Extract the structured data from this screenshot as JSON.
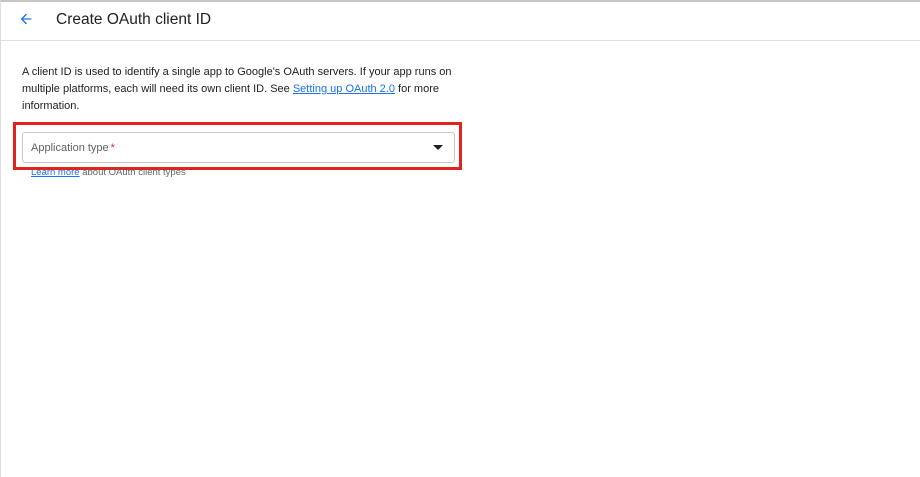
{
  "header": {
    "title": "Create OAuth client ID",
    "back_icon": "arrow-back-icon"
  },
  "intro": {
    "text_before_link": "A client ID is used to identify a single app to Google's OAuth servers. If your app runs on multiple platforms, each will need its own client ID. See ",
    "link_text": "Setting up OAuth 2.0",
    "text_after_link": " for more information."
  },
  "application_type": {
    "label": "Application type",
    "required_marker": "*",
    "value": "",
    "dropdown_icon": "arrow-drop-down-icon"
  },
  "helper": {
    "link_text": "Learn more",
    "text": " about OAuth client types"
  },
  "colors": {
    "accent": "#1a73e8",
    "highlight": "#e0231b",
    "required": "#d93025"
  }
}
